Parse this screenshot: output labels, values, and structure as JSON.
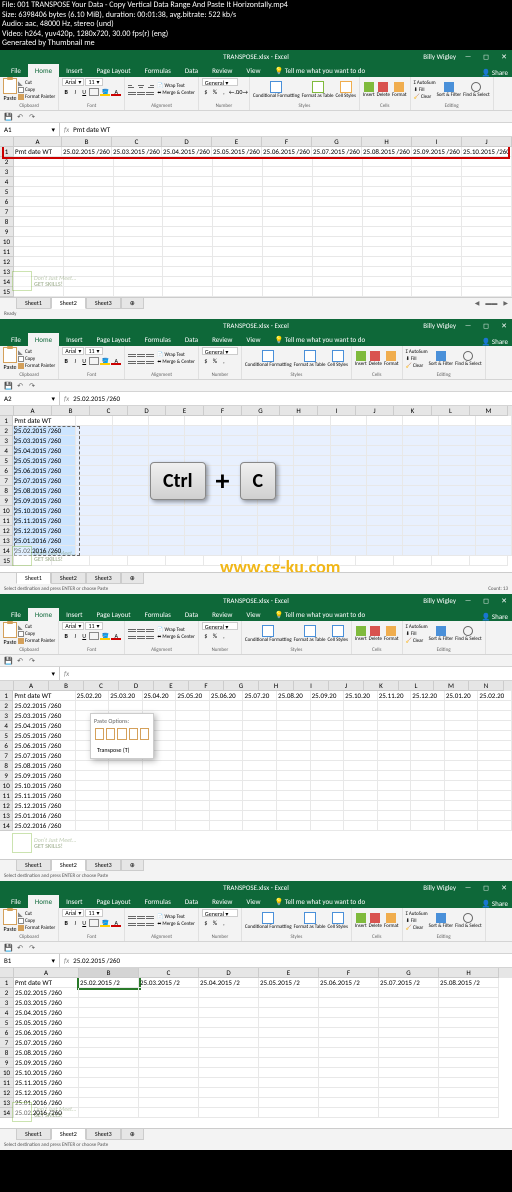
{
  "video_info": {
    "file": "File: 001 TRANSPOSE Your Data - Copy Vertical Data Range And Paste It Horizontally.mp4",
    "size": "Size: 6398406 bytes (6.10 MiB), duration: 00:01:38, avg.bitrate: 522 kb/s",
    "audio": "Audio: aac, 48000 Hz, stereo (und)",
    "video": "Video: h264, yuv420p, 1280x720, 30.00 fps(r) (eng)",
    "gen": "Generated by Thumbnail me"
  },
  "cg_watermark": "www.cg-ku.com",
  "common": {
    "title_doc": "TRANSPOSE.xlsx - Excel",
    "user": "Billy Wigley",
    "share": "Share",
    "tabs": [
      "File",
      "Home",
      "Insert",
      "Page Layout",
      "Formulas",
      "Data",
      "Review",
      "View"
    ],
    "tell_me": "Tell me what you want to do",
    "clipboard": {
      "label": "Clipboard",
      "paste": "Paste",
      "cut": "Cut",
      "copy": "Copy",
      "fp": "Format Painter"
    },
    "font": {
      "label": "Font",
      "name": "Arial",
      "size": "11"
    },
    "alignment": {
      "label": "Alignment",
      "wrap": "Wrap Text",
      "merge": "Merge & Center"
    },
    "number": {
      "label": "Number",
      "fmt": "General"
    },
    "styles": {
      "label": "Styles",
      "cond": "Conditional Formatting",
      "fat": "Format as Table",
      "cs": "Cell Styles"
    },
    "cells": {
      "label": "Cells",
      "ins": "Insert",
      "del": "Delete",
      "fmt": "Format"
    },
    "editing": {
      "label": "Editing",
      "sum": "AutoSum",
      "fill": "Fill",
      "clear": "Clear",
      "sort": "Sort & Filter",
      "find": "Find & Select"
    },
    "sheets_label": "Sheet",
    "status_ready": "Ready",
    "status_dest": "Select destination and press ENTER or choose Paste",
    "watermark": {
      "line1": "Don't Just Meet...",
      "line2": "GET SKILLS!"
    }
  },
  "chart_data": null,
  "panel1": {
    "namebox": "A1",
    "formula": "Pmt date WT",
    "sheets": [
      "Sheet1",
      "Sheet2",
      "Sheet3"
    ],
    "active_sheet": 1,
    "status": "Ready",
    "header_cell": "Pmt date WT",
    "row_data": [
      "25.02.2015 /260",
      "25.03.2015 /260",
      "25.04.2015 /260",
      "25.05.2015 /260",
      "25.06.2015 /260",
      "25.07.2015 /260",
      "25.08.2015 /260",
      "25.09.2015 /260",
      "25.10.2015 /260"
    ]
  },
  "panel2": {
    "namebox": "A2",
    "formula": "25.02.2015 /260",
    "sheets": [
      "Sheet1",
      "Sheet2",
      "Sheet3"
    ],
    "active_sheet": 0,
    "count_txt": "Count: 13",
    "key1": "Ctrl",
    "key2": "C",
    "col_data": [
      "Pmt date WT",
      "25.02.2015 /260",
      "25.03.2015 /260",
      "25.04.2015 /260",
      "25.05.2015 /260",
      "25.06.2015 /260",
      "25.07.2015 /260",
      "25.08.2015 /260",
      "25.09.2015 /260",
      "25.10.2015 /260",
      "25.11.2015 /260",
      "25.12.2015 /260",
      "25.01.2016 /260",
      "25.02.2016 /260"
    ],
    "cols": [
      "A",
      "B",
      "C",
      "D",
      "E",
      "F",
      "G",
      "H",
      "I",
      "J",
      "K",
      "L",
      "M"
    ]
  },
  "panel3": {
    "namebox": "",
    "formula": "",
    "sheets": [
      "Sheet1",
      "Sheet2",
      "Sheet3"
    ],
    "active_sheet": 1,
    "paste_popup": {
      "header": "Paste Options:",
      "transpose": "Transpose (T)"
    },
    "header_cell": "Pmt date WT",
    "row1": [
      "25.02.20",
      "25.03.20",
      "25.04.20",
      "25.05.20",
      "25.06.20",
      "25.07.20",
      "25.08.20",
      "25.09.20",
      "25.10.20",
      "25.11.20",
      "25.12.20",
      "25.01.20",
      "25.02.20"
    ],
    "col_data": [
      "25.02.2015 /260",
      "25.03.2015 /260",
      "25.04.2015 /260",
      "25.05.2015 /260",
      "25.06.2015 /260",
      "25.07.2015 /260",
      "25.08.2015 /260",
      "25.09.2015 /260",
      "25.10.2015 /260",
      "25.11.2015 /260",
      "25.12.2015 /260",
      "25.01.2016 /260",
      "25.02.2016 /260"
    ],
    "cols": [
      "A",
      "B",
      "C",
      "D",
      "E",
      "F",
      "G",
      "H",
      "I",
      "J",
      "K",
      "L",
      "M",
      "N"
    ]
  },
  "panel4": {
    "namebox": "B1",
    "formula": "25.02.2015 /260",
    "sheets": [
      "Sheet1",
      "Sheet2",
      "Sheet3"
    ],
    "active_sheet": 1,
    "header_cell": "Pmt date WT",
    "row1": [
      "25.02.2015 /2",
      "25.03.2015 /2",
      "25.04.2015 /2",
      "25.05.2015 /2",
      "25.06.2015 /2",
      "25.07.2015 /2",
      "25.08.2015 /2"
    ],
    "col_data": [
      "25.02.2015 /260",
      "25.03.2015 /260",
      "25.04.2015 /260",
      "25.05.2015 /260",
      "25.06.2015 /260",
      "25.07.2015 /260",
      "25.08.2015 /260",
      "25.09.2015 /260",
      "25.10.2015 /260",
      "25.11.2015 /260",
      "25.12.2015 /260",
      "25.01.2016 /260",
      "25.02.2016 /260"
    ],
    "cols": [
      "A",
      "B",
      "C",
      "D",
      "E",
      "F",
      "G",
      "H"
    ]
  }
}
